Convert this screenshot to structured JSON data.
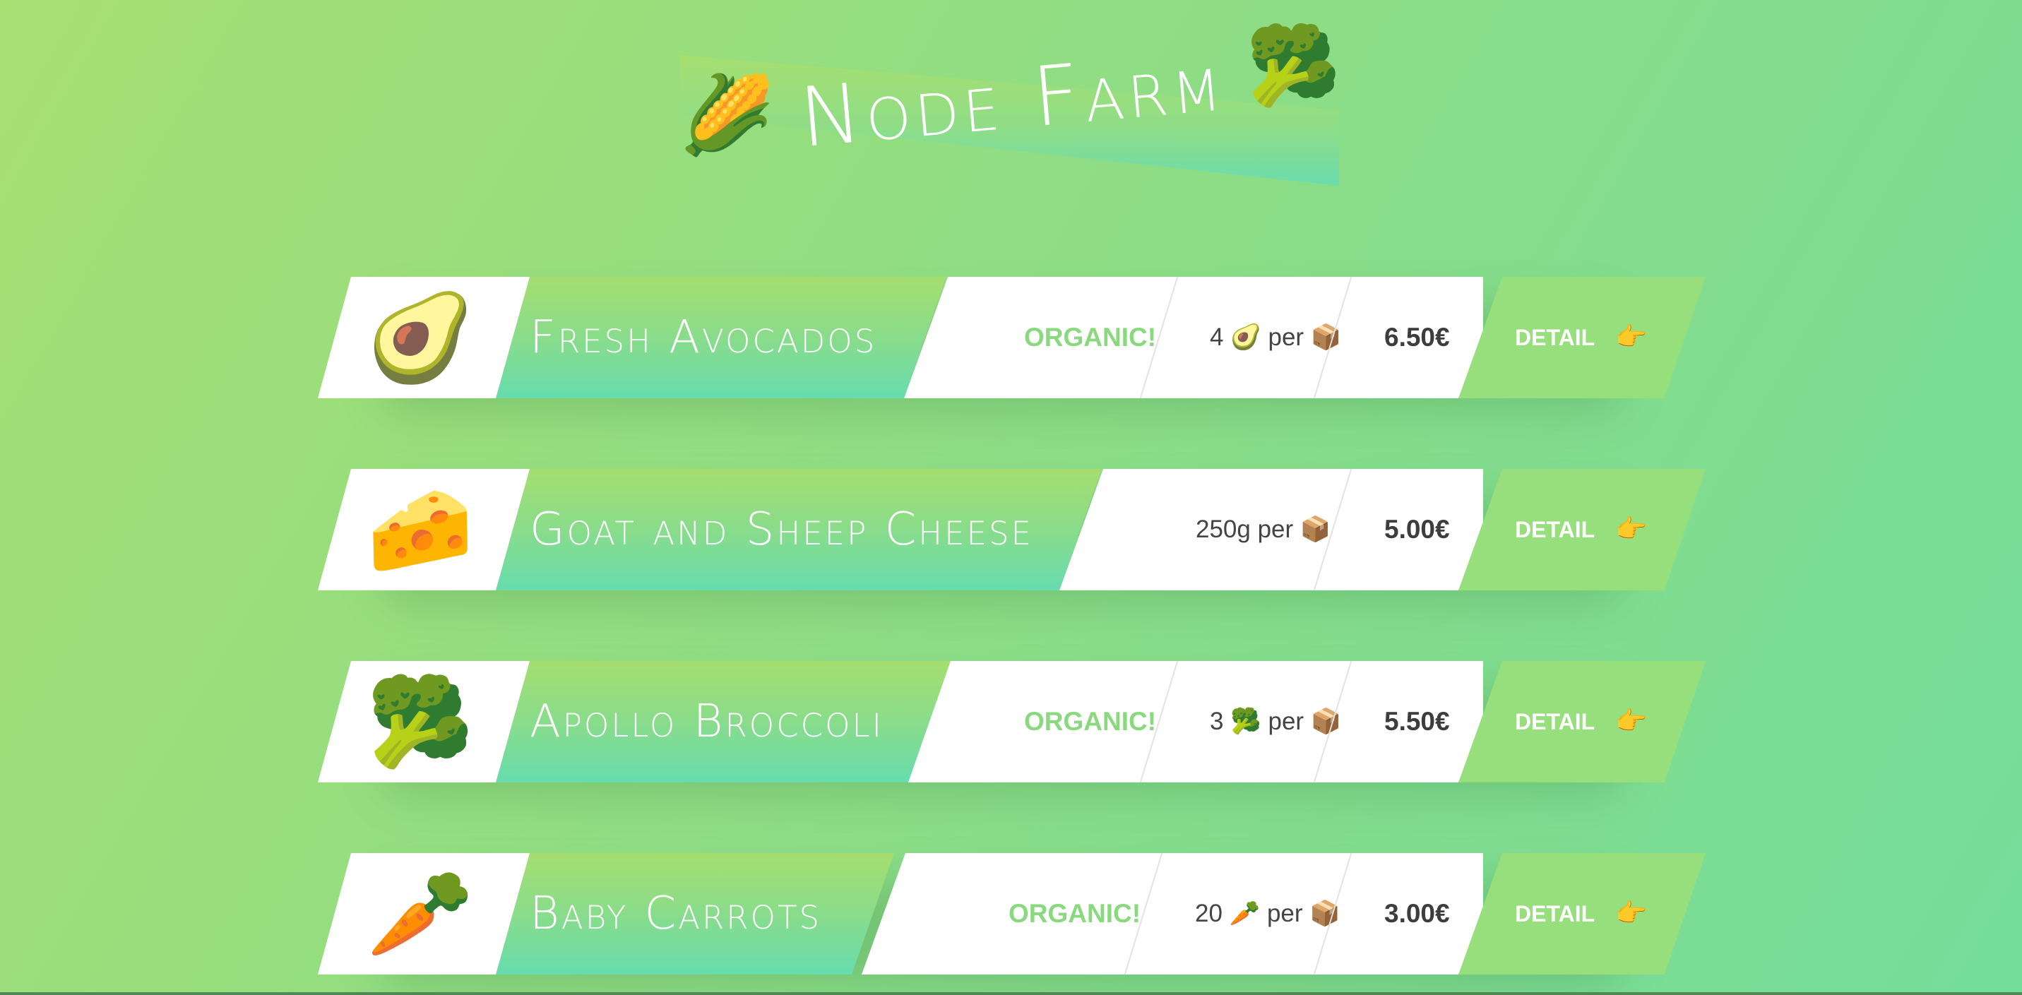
{
  "header": {
    "title": "Node Farm",
    "left_icon": "🌽",
    "right_icon": "🥦"
  },
  "products": [
    {
      "image": "🥑",
      "name": "Fresh Avocados",
      "organic": "ORGANIC!",
      "quantity": "4 🥑 per 📦",
      "price": "6.50€",
      "detail": "DETAIL",
      "detail_icon": "👉"
    },
    {
      "image": "🧀",
      "name": "Goat and Sheep Cheese",
      "organic": "",
      "quantity": "250g per 📦",
      "price": "5.00€",
      "detail": "DETAIL",
      "detail_icon": "👉"
    },
    {
      "image": "🥦",
      "name": "Apollo Broccoli",
      "organic": "ORGANIC!",
      "quantity": "3 🥦 per 📦",
      "price": "5.50€",
      "detail": "DETAIL",
      "detail_icon": "👉"
    },
    {
      "image": "🥕",
      "name": "Baby Carrots",
      "organic": "ORGANIC!",
      "quantity": "20 🥕 per 📦",
      "price": "3.00€",
      "detail": "DETAIL",
      "detail_icon": "👉"
    }
  ],
  "colors": {
    "background_start": "#a7df73",
    "background_end": "#74dd9b",
    "organic": "#8ad97f",
    "detail_bg": "#97de7c",
    "name_gradient_top": "#a5de6f",
    "name_gradient_bottom": "#67dcae"
  }
}
